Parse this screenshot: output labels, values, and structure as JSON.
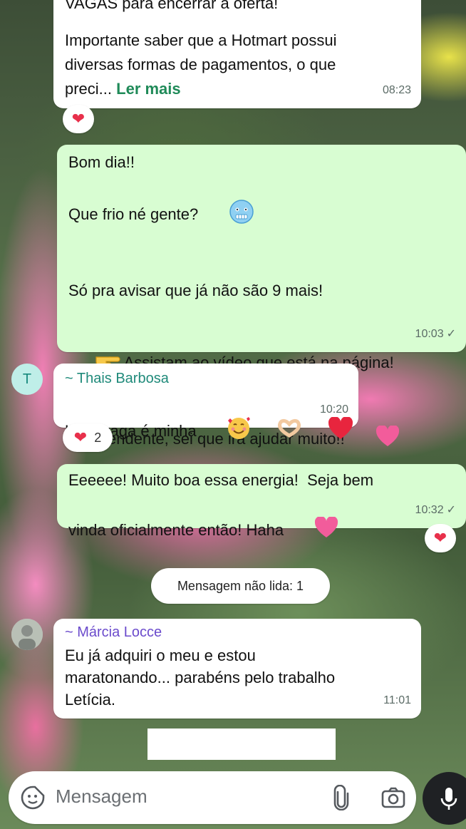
{
  "colors": {
    "incoming_bubble": "#ffffff",
    "outgoing_bubble": "#d8fdd2",
    "read_more": "#1f8a58",
    "thais_name": "#1f8a7a",
    "marcia_name": "#6b4bcc"
  },
  "messages": [
    {
      "type": "incoming",
      "lines": [
        "VAGAS para encerrar a oferta!",
        "",
        "Importante saber que a Hotmart possui",
        "diversas formas de pagamentos, o que"
      ],
      "last_line_prefix": "preci... ",
      "read_more": "Ler mais",
      "time": "08:23",
      "reaction": {
        "emoji": "❤",
        "icon": "heart-icon"
      }
    },
    {
      "type": "outgoing",
      "lines": [
        "Bom dia!!",
        "Que frio né gente?",
        "",
        "Só pra avisar que já não são 9 mais!",
        "",
        "Assistam ao vídeo que está na página!",
        "Independente, sei que irá ajudar muito!!"
      ],
      "time": "10:03",
      "status_icon": "single-check-icon"
    },
    {
      "type": "incoming",
      "sender": "~ Thais Barbosa",
      "avatar_letter": "T",
      "text": "Uma vaga é minha",
      "time": "10:20",
      "reaction": {
        "emoji": "❤",
        "count": "2",
        "icon": "heart-icon"
      }
    },
    {
      "type": "outgoing",
      "lines": [
        "Eeeeee! Muito boa essa energia!  Seja bem",
        "vinda oficialmente então! Haha"
      ],
      "time": "10:32",
      "status_icon": "single-check-icon",
      "reaction": {
        "emoji": "❤",
        "icon": "heart-icon"
      }
    },
    {
      "type": "incoming",
      "sender": "~ Márcia Locce",
      "lines": [
        "Eu já adquiri o meu e estou",
        "maratonando... parabéns pelo trabalho",
        "Letícia."
      ],
      "time": "11:01"
    }
  ],
  "unread_divider": "Mensagem não lida: 1",
  "composer": {
    "placeholder": "Mensagem",
    "icons": [
      "sticker-icon",
      "attach-icon",
      "camera-icon",
      "mic-icon"
    ]
  }
}
